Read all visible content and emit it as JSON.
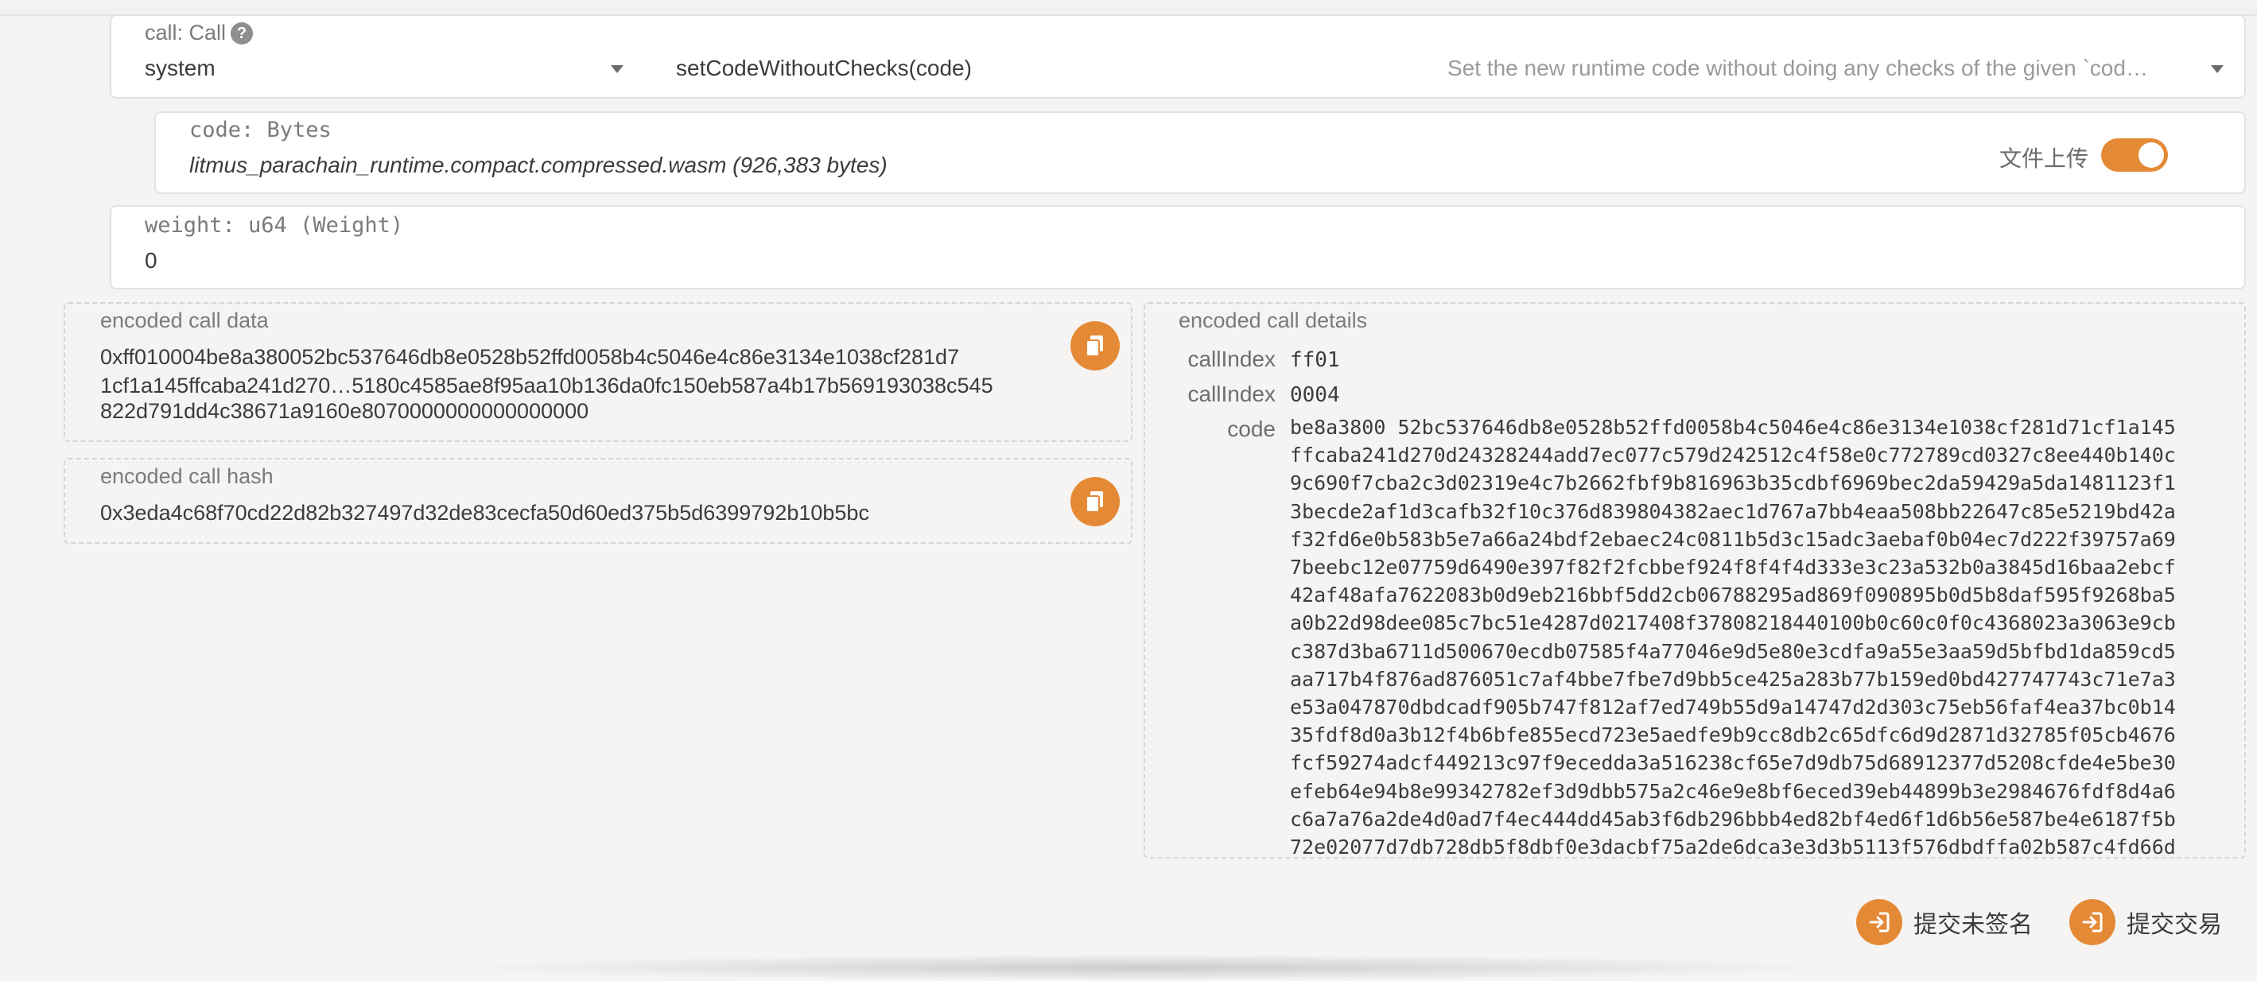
{
  "call": {
    "label": "call: Call",
    "help_icon": "?",
    "pallet": "system",
    "method": "setCodeWithoutChecks(code)",
    "description": "Set the new runtime code without doing any checks of the given `cod…"
  },
  "code_param": {
    "label": "code: Bytes",
    "value": "litmus_parachain_runtime.compact.compressed.wasm (926,383 bytes)",
    "upload_label": "文件上传",
    "upload_toggle_on": true
  },
  "weight_param": {
    "label": "weight: u64 (Weight)",
    "value": "0"
  },
  "encoded_data": {
    "label": "encoded call data",
    "lines": [
      "0xff010004be8a380052bc537646db8e0528b52ffd0058b4c5046e4c86e3134e1038cf281d7",
      "1cf1a145ffcaba241d270…5180c4585ae8f95aa10b136da0fc150eb587a4b17b569193038c545",
      "822d791dd4c38671a9160e8070000000000000000"
    ]
  },
  "encoded_hash": {
    "label": "encoded call hash",
    "value": "0x3eda4c68f70cd22d82b327497d32de83cecfa50d60ed375b5d6399792b10b5bc"
  },
  "details": {
    "label": "encoded call details",
    "rows": [
      {
        "key": "callIndex",
        "value": "ff01"
      },
      {
        "key": "callIndex",
        "value": "0004"
      }
    ],
    "code_key": "code",
    "code_lines": [
      "be8a3800 52bc537646db8e0528b52ffd0058b4c5046e4c86e3134e1038cf281d71cf1a145",
      "ffcaba241d270d24328244add7ec077c579d242512c4f58e0c772789cd0327c8ee440b140c",
      "9c690f7cba2c3d02319e4c7b2662fbf9b816963b35cdbf6969bec2da59429a5da1481123f1",
      "3becde2af1d3cafb32f10c376d839804382aec1d767a7bb4eaa508bb22647c85e5219bd42a",
      "f32fd6e0b583b5e7a66a24bdf2ebaec24c0811b5d3c15adc3aebaf0b04ec7d222f39757a69",
      "7beebc12e07759d6490e397f82f2fcbbef924f8f4f4d333e3c23a532b0a3845d16baa2ebcf",
      "42af48afa7622083b0d9eb216bbf5dd2cb06788295ad869f090895b0d5b8daf595f9268ba5",
      "a0b22d98dee085c7bc51e4287d0217408f37808218440100b0c60c0f0c4368023a3063e9cb",
      "c387d3ba6711d500670ecdb07585f4a77046e9d5e80e3cdfa9a55e3aa59d5bfbd1da859cd5",
      "aa717b4f876ad876051c7af4bbe7fbe7d9bb5ce425a283b77b159ed0bd427747743c71e7a3",
      "e53a047870dbdcadf905b747f812af7ed749b55d9a14747d2d303c75eb56faf4ea37bc0b14",
      "35fdf8d0a3b12f4b6bfe855ecd723e5aedfe9b9cc8db2c65dfc6d9d2871d32785f05cb4676",
      "fcf59274adcf449213c97f9ecedda3a516238cf65e7d9db75d68912377d5208cfde4e5be30",
      "efeb64e94b8e99342782ef3d9dbb575a2c46e9e8bf6eced39eb44899b3e2984676fdf8d4a6",
      "c6a7a76a2de4d0ad7f4ec444dd45ab3f6db296bbb4ed82bf4ed6f1d6b56e587be4e6187f5b",
      "72e02077d7db728db5f8dbf0e3dacbf75a2de6dca3e3d3b5113f576dbdffa02b587c4fd66d"
    ]
  },
  "actions": {
    "submit_unsigned": "提交未签名",
    "submit_transaction": "提交交易"
  },
  "colors": {
    "accent": "#e48a37",
    "background": "#f5f4f3"
  }
}
